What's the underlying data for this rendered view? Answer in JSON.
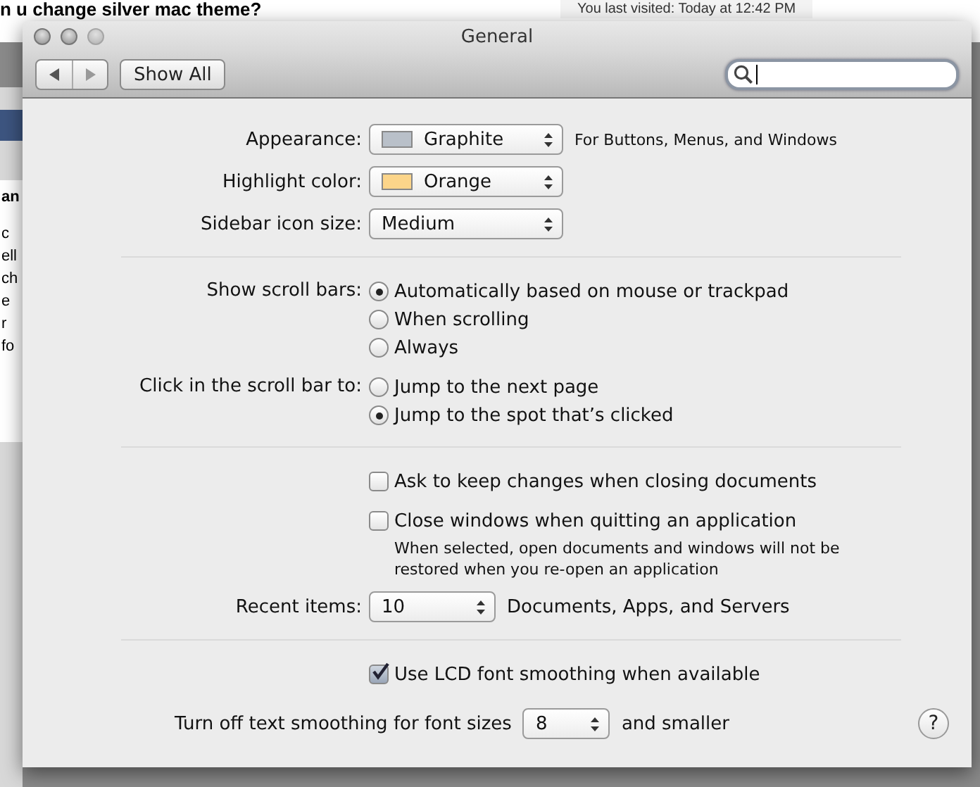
{
  "background_page": {
    "heading": "n u change silver mac theme?",
    "last_visited": "You last visited: Today at 12:42 PM",
    "side_fragments": [
      {
        "text": "an",
        "bold": true
      },
      {
        "text": "c",
        "bold": false
      },
      {
        "text": "ell",
        "bold": false
      },
      {
        "text": "ch",
        "bold": false
      },
      {
        "text": "e",
        "bold": false
      },
      {
        "text": "r",
        "bold": false
      },
      {
        "text": "fo",
        "bold": false
      }
    ]
  },
  "window": {
    "title": "General"
  },
  "toolbar": {
    "show_all": "Show All"
  },
  "sections": [
    [
      {
        "kind": "popup",
        "label": "Appearance:",
        "value": "Graphite",
        "color": "#b9c0c9",
        "note": "For Buttons, Menus, and Windows"
      },
      {
        "kind": "popup",
        "label": "Highlight color:",
        "value": "Orange",
        "color": "#fcd58a"
      },
      {
        "kind": "popup",
        "label": "Sidebar icon size:",
        "value": "Medium"
      }
    ],
    [
      {
        "kind": "radios",
        "label": "Show scroll bars:",
        "options": [
          {
            "text": "Automatically based on mouse or trackpad",
            "selected": true
          },
          {
            "text": "When scrolling",
            "selected": false
          },
          {
            "text": "Always",
            "selected": false
          }
        ]
      },
      {
        "kind": "radios",
        "label": "Click in the scroll bar to:",
        "options": [
          {
            "text": "Jump to the next page",
            "selected": false
          },
          {
            "text": "Jump to the spot that’s clicked",
            "selected": true
          }
        ]
      }
    ],
    [
      {
        "kind": "checkbox",
        "text": "Ask to keep changes when closing documents",
        "checked": false
      },
      {
        "kind": "checkbox",
        "text": "Close windows when quitting an application",
        "checked": false,
        "note": "When selected, open documents and windows will not be restored when you re-open an application"
      },
      {
        "kind": "stepper",
        "label": "Recent items:",
        "value": "10",
        "note": "Documents, Apps, and Servers"
      }
    ],
    [
      {
        "kind": "checkbox",
        "text": "Use LCD font smoothing when available",
        "checked": true
      },
      {
        "kind": "inline_stepper",
        "label": "Turn off text smoothing for font sizes",
        "value": "8",
        "note": "and smaller"
      }
    ]
  ],
  "help": "?"
}
